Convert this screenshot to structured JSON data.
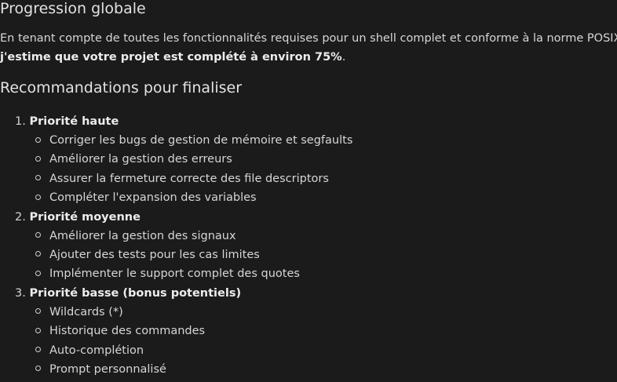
{
  "section1": {
    "title": "Progression globale",
    "intro_text": "En tenant compte de toutes les fonctionnalités requises pour un shell complet et conforme à la norme POSIX,",
    "intro_bold": "j'estime que votre projet est complété à environ 75%",
    "intro_end": "."
  },
  "section2": {
    "title": "Recommandations pour finaliser",
    "groups": [
      {
        "number": "1.",
        "label": "Priorité haute",
        "items": [
          "Corriger les bugs de gestion de mémoire et segfaults",
          "Améliorer la gestion des erreurs",
          "Assurer la fermeture correcte des file descriptors",
          "Compléter l'expansion des variables"
        ]
      },
      {
        "number": "2.",
        "label": "Priorité moyenne",
        "items": [
          "Améliorer la gestion des signaux",
          "Ajouter des tests pour les cas limites",
          "Implémenter le support complet des quotes"
        ]
      },
      {
        "number": "3.",
        "label": "Priorité basse (bonus potentiels)",
        "items": [
          "Wildcards (*)",
          "Historique des commandes",
          "Auto-complétion",
          "Prompt personnalisé"
        ]
      }
    ]
  }
}
